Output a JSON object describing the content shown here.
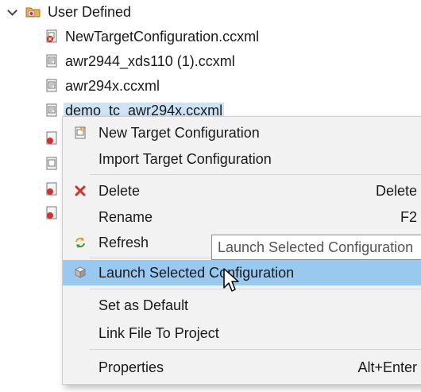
{
  "tree": {
    "folder": {
      "label": "User Defined",
      "expanded": true,
      "icon": "folder-config-icon"
    },
    "items": [
      {
        "label": "NewTargetConfiguration.ccxml",
        "icon": "ccxml-file-error-icon"
      },
      {
        "label": "awr2944_xds110 (1).ccxml",
        "icon": "ccxml-file-icon"
      },
      {
        "label": "awr294x.ccxml",
        "icon": "ccxml-file-icon"
      },
      {
        "label": "demo_tc_awr294x.ccxml",
        "icon": "ccxml-file-icon",
        "selected": true
      }
    ]
  },
  "context_menu": {
    "items": [
      {
        "label": "New Target Configuration",
        "shortcut": "",
        "icon": "new-target-config-icon"
      },
      {
        "label": "Import Target Configuration",
        "shortcut": "",
        "icon": ""
      },
      {
        "label": "Delete",
        "shortcut": "Delete",
        "icon": "delete-x-icon"
      },
      {
        "label": "Rename",
        "shortcut": "F2",
        "icon": ""
      },
      {
        "label": "Refresh",
        "shortcut": "",
        "icon": "refresh-icon"
      },
      {
        "label": "Launch Selected Configuration",
        "shortcut": "",
        "icon": "launch-config-icon",
        "highlighted": true
      },
      {
        "label": "Set as Default",
        "shortcut": "",
        "icon": ""
      },
      {
        "label": "Link File To Project",
        "shortcut": "",
        "icon": ""
      },
      {
        "label": "Properties",
        "shortcut": "Alt+Enter",
        "icon": ""
      }
    ]
  },
  "tooltip": {
    "text": "Launch Selected Configuration"
  },
  "colors": {
    "selection": "#cde4f7",
    "menu_highlight": "#99c9ef",
    "menu_background": "#f2f2f2",
    "delete_icon": "#d62d2d"
  }
}
